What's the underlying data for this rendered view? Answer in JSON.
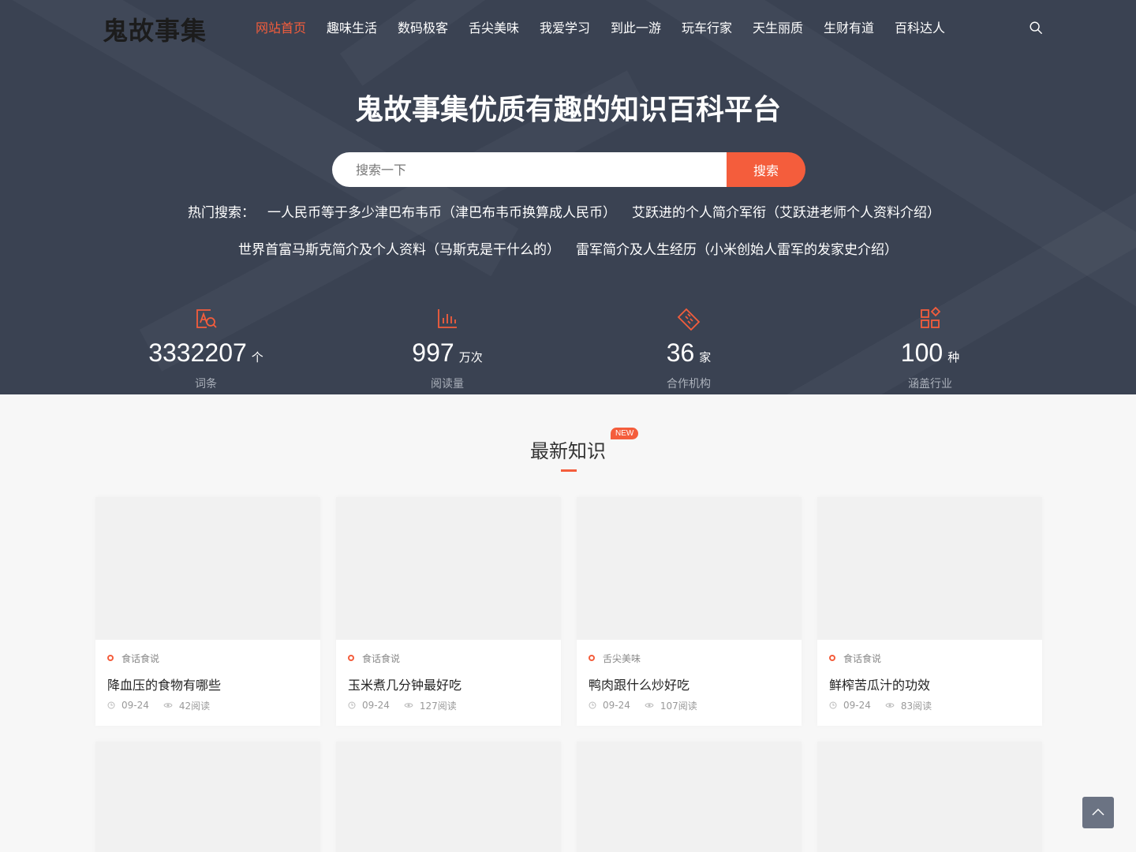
{
  "site": {
    "logo": "鬼故事集"
  },
  "nav": {
    "items": [
      {
        "label": "网站首页",
        "active": true
      },
      {
        "label": "趣味生活"
      },
      {
        "label": "数码极客"
      },
      {
        "label": "舌尖美味"
      },
      {
        "label": "我爱学习"
      },
      {
        "label": "到此一游"
      },
      {
        "label": "玩车行家"
      },
      {
        "label": "天生丽质"
      },
      {
        "label": "生财有道"
      },
      {
        "label": "百科达人"
      }
    ],
    "search_icon": "search-icon"
  },
  "hero": {
    "title": "鬼故事集优质有趣的知识百科平台",
    "search": {
      "placeholder": "搜索一下",
      "value": "",
      "button": "搜索"
    },
    "hot_label": "热门搜索：",
    "hot": [
      "一人民币等于多少津巴布韦币（津巴布韦币换算成人民币）",
      "艾跃进的个人简介军衔（艾跃进老师个人资料介绍）",
      "世界首富马斯克简介及个人资料（马斯克是干什么的）",
      "雷军简介及人生经历（小米创始人雷军的发家史介绍）"
    ]
  },
  "stats": [
    {
      "icon": "text-search-icon",
      "value": "3332207",
      "unit": "个",
      "label": "词条"
    },
    {
      "icon": "bar-chart-icon",
      "value": "997",
      "unit": "万次",
      "label": "阅读量"
    },
    {
      "icon": "handshake-icon",
      "value": "36",
      "unit": "家",
      "label": "合作机构"
    },
    {
      "icon": "apps-grid-icon",
      "value": "100",
      "unit": "种",
      "label": "涵盖行业"
    }
  ],
  "section": {
    "title": "最新知识",
    "badge": "NEW"
  },
  "cards": [
    {
      "category": "食话食说",
      "title": "降血压的食物有哪些",
      "date": "09-24",
      "reads": "42阅读"
    },
    {
      "category": "食话食说",
      "title": "玉米煮几分钟最好吃",
      "date": "09-24",
      "reads": "127阅读"
    },
    {
      "category": "舌尖美味",
      "title": "鸭肉跟什么炒好吃",
      "date": "09-24",
      "reads": "107阅读"
    },
    {
      "category": "食话食说",
      "title": "鲜榨苦瓜汁的功效",
      "date": "09-24",
      "reads": "83阅读"
    }
  ],
  "colors": {
    "accent": "#f45d3c",
    "hero_bg": "#3a4252"
  }
}
